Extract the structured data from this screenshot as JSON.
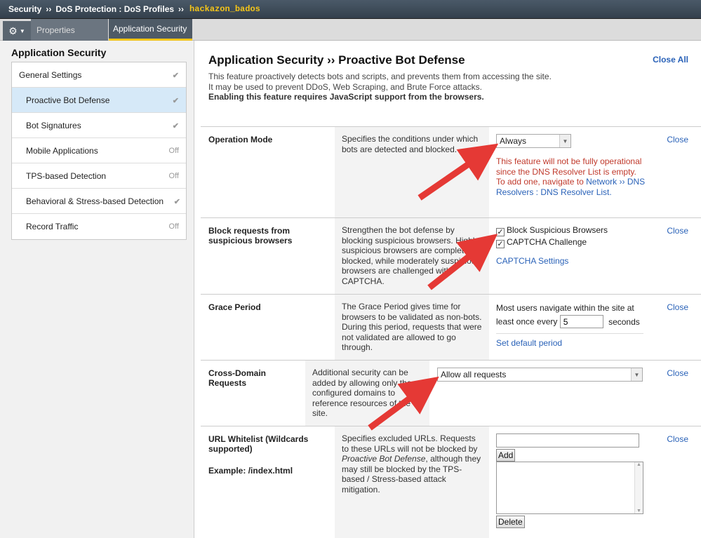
{
  "breadcrumb": {
    "items": [
      "Security",
      "DoS Protection : DoS Profiles"
    ],
    "separator": "››",
    "current": "hackazon_bados"
  },
  "tabs": {
    "gear_icon": "gear-icon",
    "items": [
      "Properties",
      "Application Security"
    ],
    "active": "Application Security"
  },
  "sidebar": {
    "title": "Application Security",
    "items": [
      {
        "label": "General Settings",
        "status": "check"
      },
      {
        "label": "Proactive Bot Defense",
        "status": "check"
      },
      {
        "label": "Bot Signatures",
        "status": "check"
      },
      {
        "label": "Mobile Applications",
        "status": "Off"
      },
      {
        "label": "TPS-based Detection",
        "status": "Off"
      },
      {
        "label": "Behavioral & Stress-based Detection",
        "status": "check"
      },
      {
        "label": "Record Traffic",
        "status": "Off"
      }
    ]
  },
  "main": {
    "title": "Application Security ›› Proactive Bot Defense",
    "close_all": "Close All",
    "intro_line1": "This feature proactively detects bots and scripts, and prevents them from accessing the site.",
    "intro_line2": "It may be used to prevent DDoS, Web Scraping, and Brute Force attacks.",
    "intro_line3": "Enabling this feature requires JavaScript support from the browsers.",
    "close_label": "Close",
    "operation_mode": {
      "label": "Operation Mode",
      "description": "Specifies the conditions under which bots are detected and blocked.",
      "value": "Always",
      "warning": "This feature will not be fully operational since the DNS Resolver List is empty. To add one, navigate to",
      "warning_link_1": "Network",
      "warning_link_sep": "››",
      "warning_link_2": "DNS Resolvers : DNS Resolver List."
    },
    "block_requests": {
      "label": "Block requests from suspicious browsers",
      "description": "Strengthen the bot defense by blocking suspicious browsers. Highly suspicious browsers are completely blocked, while moderately suspicious browsers are challenged with CAPTCHA.",
      "option1": "Block Suspicious Browsers",
      "option1_checked": true,
      "option2": "CAPTCHA Challenge",
      "option2_checked": true,
      "link": "CAPTCHA Settings"
    },
    "grace_period": {
      "label": "Grace Period",
      "description": "The Grace Period gives time for browsers to be validated as non-bots. During this period, requests that were not validated are allowed to go through.",
      "text_before": "Most users navigate within the site at least once every",
      "value": "5",
      "unit": "seconds",
      "link": "Set default period"
    },
    "cross_domain": {
      "label": "Cross-Domain Requests",
      "description": "Additional security can be added by allowing only the configured domains to reference resources of the site.",
      "value": "Allow all requests"
    },
    "url_whitelist": {
      "label": "URL Whitelist (Wildcards supported)",
      "example": "Example: /index.html",
      "description_1": "Specifies excluded URLs. Requests to these URLs will not be blocked by",
      "description_em": "Proactive Bot Defense",
      "description_2": ", although they may still be blocked by the TPS-based / Stress-based attack mitigation.",
      "add_button": "Add",
      "delete_button": "Delete"
    }
  },
  "colors": {
    "accent": "#f5c518",
    "link": "#2a62b8",
    "check": "#3a9d23",
    "warning": "#c0392b",
    "arrow": "#e53935"
  }
}
